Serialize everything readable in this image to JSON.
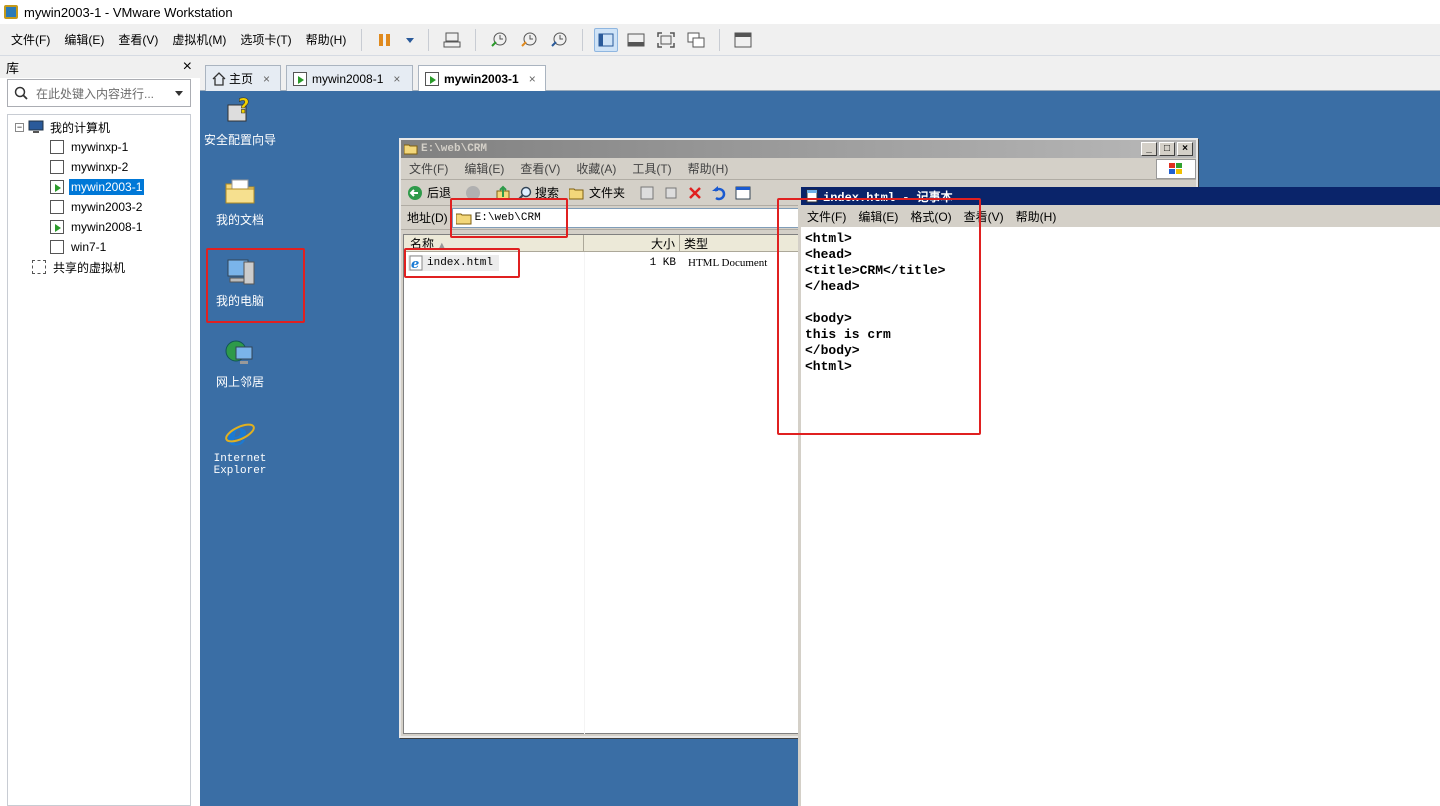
{
  "window": {
    "title": "mywin2003-1 - VMware Workstation"
  },
  "menu": [
    "文件(F)",
    "编辑(E)",
    "查看(V)",
    "虚拟机(M)",
    "选项卡(T)",
    "帮助(H)"
  ],
  "toolbar": {
    "icons": [
      "pause-icon",
      "send-keys-icon",
      "snapshot-icon",
      "revert-snapshot-icon",
      "snapshot-manager-icon",
      "library-view-icon",
      "console-view-icon",
      "fullscreen-icon",
      "unity-icon",
      "thumbnail-icon"
    ]
  },
  "library": {
    "title": "库",
    "close": "×",
    "search_placeholder": "在此处键入内容进行...",
    "tree": {
      "root": "我的计算机",
      "vms": [
        "mywinxp-1",
        "mywinxp-2",
        "mywin2003-1",
        "mywin2003-2",
        "mywin2008-1",
        "win7-1"
      ],
      "selected": "mywin2003-1",
      "shared": "共享的虚拟机"
    }
  },
  "tabs": [
    {
      "label": "主页",
      "close": "×"
    },
    {
      "label": "mywin2008-1",
      "close": "×"
    },
    {
      "label": "mywin2003-1",
      "close": "×"
    }
  ],
  "desktop_icons": [
    {
      "label": "安全配置向导"
    },
    {
      "label": "我的文档"
    },
    {
      "label": "我的电脑"
    },
    {
      "label": "网上邻居"
    },
    {
      "label": "Internet Explorer"
    }
  ],
  "explorer": {
    "title": "E:\\web\\CRM",
    "menu": [
      "文件(F)",
      "编辑(E)",
      "查看(V)",
      "收藏(A)",
      "工具(T)",
      "帮助(H)"
    ],
    "toolbar": {
      "back": "后退",
      "search": "搜索",
      "folders": "文件夹"
    },
    "address_label": "地址(D)",
    "address_value": "E:\\web\\CRM",
    "columns": [
      "名称",
      "大小",
      "类型"
    ],
    "files": [
      {
        "name": "index.html",
        "size": "1 KB",
        "type": "HTML Document"
      }
    ]
  },
  "notepad": {
    "title": "index.html - 记事本",
    "menu": [
      "文件(F)",
      "编辑(E)",
      "格式(O)",
      "查看(V)",
      "帮助(H)"
    ],
    "content": "<html>\n<head>\n<title>CRM</title>\n</head>\n\n<body>\nthis is crm\n</body>\n<html>"
  },
  "colors": {
    "desktop": "#3a6ea5",
    "highlight": "#e02020",
    "selection": "#0078d7"
  }
}
